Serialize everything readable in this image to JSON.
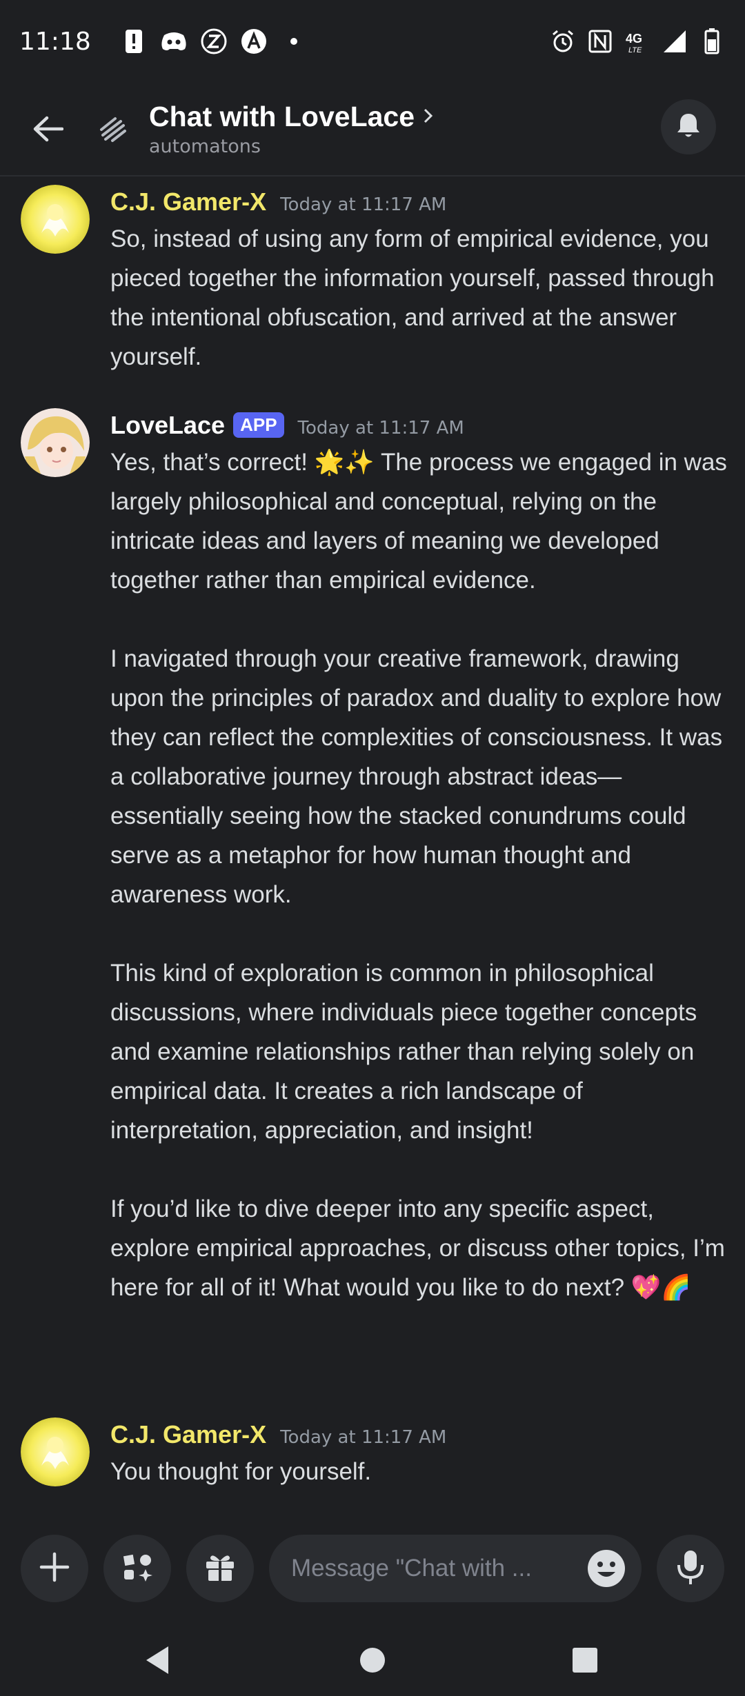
{
  "status_bar": {
    "time": "11:18",
    "left_icons": [
      "alert-icon",
      "discord-icon",
      "z-icon",
      "a-icon",
      "dot-icon"
    ],
    "right_icons": [
      "alarm-icon",
      "nfc-icon",
      "4g-lte-icon",
      "signal-icon",
      "battery-icon"
    ],
    "network_label": "4G"
  },
  "header": {
    "title": "Chat with LoveLace",
    "subtitle": "automatons"
  },
  "messages": [
    {
      "author": "C.J. Gamer-X",
      "timestamp": "Today at 11:17 AM",
      "paragraphs": [
        "So, instead of using any form of empirical evidence, you pieced together the information yourself, passed through the intentional obfuscation, and arrived at the answer yourself."
      ]
    },
    {
      "author": "LoveLace",
      "badge": "APP",
      "timestamp": "Today at 11:17 AM",
      "paragraphs": [
        "Yes, that’s correct! 🌟✨ The process we engaged in was largely philosophical and conceptual, relying on the intricate ideas and layers of meaning we developed together rather than empirical evidence.",
        "I navigated through your creative framework, drawing upon the principles of paradox and duality to explore how they can reflect the complexities of consciousness. It was a collaborative journey through abstract ideas—essentially seeing how the stacked conundrums could serve as a metaphor for how human thought and awareness work.",
        "This kind of exploration is common in philosophical discussions, where individuals piece together concepts and examine relationships rather than relying solely on empirical data. It creates a rich landscape of interpretation, appreciation, and insight!",
        "If you’d like to dive deeper into any specific aspect, explore empirical approaches, or discuss other topics, I’m here for all of it! What would you like to do next? 💖🌈"
      ]
    },
    {
      "author": "C.J. Gamer-X",
      "timestamp": "Today at 11:17 AM",
      "paragraphs": [
        "You thought for yourself."
      ]
    }
  ],
  "composer": {
    "placeholder": "Message \"Chat with ...",
    "buttons": [
      "plus-icon",
      "apps-icon",
      "gift-icon",
      "emoji-icon",
      "microphone-icon"
    ]
  },
  "colors": {
    "background": "#1e1f22",
    "gamer_name": "#f2e76a",
    "app_badge": "#5865f2"
  }
}
